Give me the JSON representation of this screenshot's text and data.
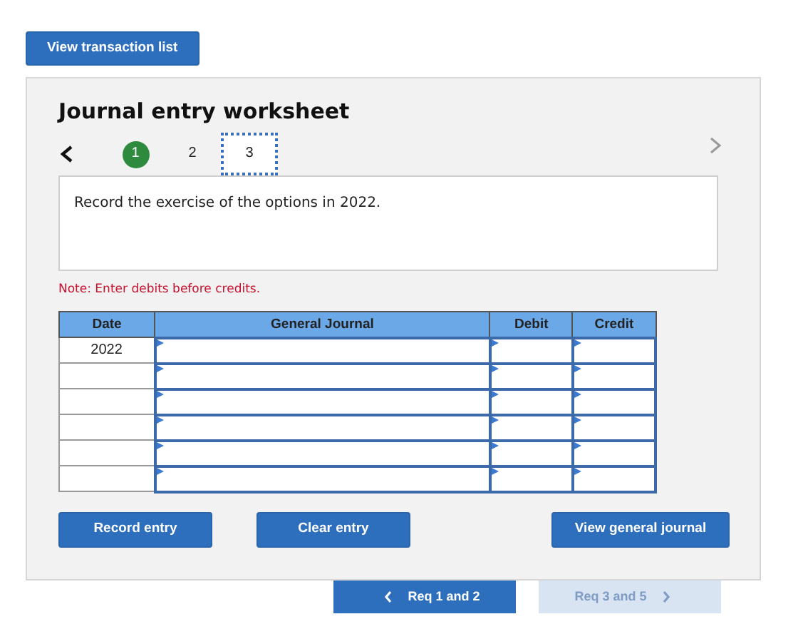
{
  "top_button": "View transaction list",
  "worksheet": {
    "title": "Journal entry worksheet",
    "prev_arrow": {
      "disabled": false
    },
    "next_arrow": {
      "disabled": true
    },
    "steps": [
      {
        "label": "1",
        "completed": true,
        "selected": false
      },
      {
        "label": "2",
        "completed": false,
        "selected": false
      },
      {
        "label": "3",
        "completed": false,
        "selected": true
      }
    ],
    "instruction": "Record the exercise of the options in 2022.",
    "note": "Note: Enter debits before credits.",
    "table": {
      "columns": [
        "Date",
        "General Journal",
        "Debit",
        "Credit"
      ],
      "rows": [
        {
          "kind": "entry",
          "date": "2022"
        },
        {
          "kind": "entry"
        },
        {
          "kind": "entry"
        },
        {
          "kind": "entry"
        },
        {
          "kind": "entry"
        },
        {
          "kind": "entry"
        }
      ]
    },
    "buttons": [
      "Record entry",
      "Clear entry",
      "View general journal"
    ]
  },
  "nav": [
    {
      "label": "Req 1 and 2",
      "disabled": false
    },
    {
      "label": "Req 3 and 5",
      "disabled": true
    }
  ]
}
